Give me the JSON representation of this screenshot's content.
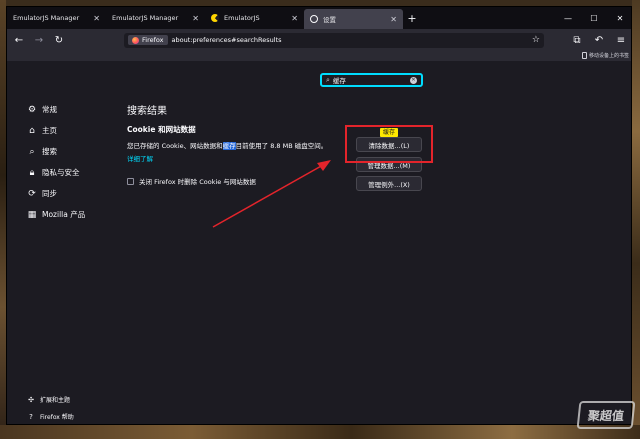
{
  "tabs": [
    {
      "title": "EmulatorJS Manager",
      "favicon": "none",
      "active": false
    },
    {
      "title": "EmulatorJS Manager",
      "favicon": "none",
      "active": false
    },
    {
      "title": "EmulatorJS",
      "favicon": "pacman-icon",
      "active": false
    },
    {
      "title": "设置",
      "favicon": "gear-icon",
      "active": true
    }
  ],
  "urlbar": {
    "identity_label": "Firefox",
    "url": "about:preferences#searchResults"
  },
  "bookmarks": {
    "mobile_bookmarks": "移动设备上的书签"
  },
  "search": {
    "value": "缓存"
  },
  "sidebar": {
    "items": [
      {
        "label": "常规",
        "icon": "gear-icon"
      },
      {
        "label": "主页",
        "icon": "home-icon"
      },
      {
        "label": "搜索",
        "icon": "search-icon"
      },
      {
        "label": "隐私与安全",
        "icon": "lock-icon"
      },
      {
        "label": "同步",
        "icon": "sync-icon"
      },
      {
        "label": "Mozilla 产品",
        "icon": "mozilla-icon"
      }
    ],
    "footer": [
      {
        "label": "扩展和主题",
        "icon": "puzzle-icon"
      },
      {
        "label": "Firefox 帮助",
        "icon": "help-icon"
      }
    ]
  },
  "main": {
    "page_title": "搜索结果",
    "section_title": "Cookie 和网站数据",
    "desc_before": "您已存储的 Cookie、网站数据和",
    "desc_highlight": "缓存",
    "desc_after": "目前使用了 8.8 MB 磁盘空间。",
    "learn_more": "详细了解",
    "checkbox_label": "关闭 Firefox 时删除 Cookie 与网站数据",
    "tooltip": "缓存",
    "buttons": {
      "clear": "清除数据...(L)",
      "manage": "管理数据...(M)",
      "exceptions": "管理例外...(X)"
    }
  },
  "watermark": "聚超值",
  "colors": {
    "accent": "#00ddff",
    "annotation": "#e3242b",
    "highlight": "#2467d8",
    "tooltip": "#ffe900"
  }
}
